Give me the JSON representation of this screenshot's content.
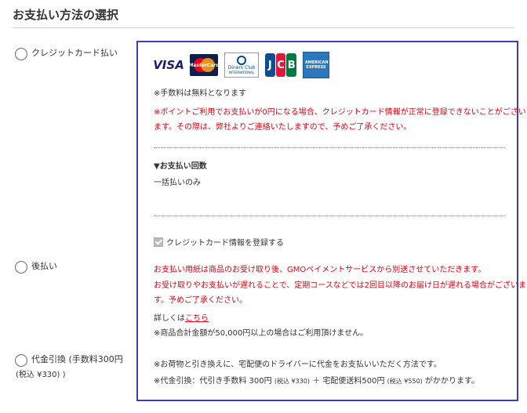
{
  "section": {
    "title": "お支払い方法の選択"
  },
  "payment_options": [
    {
      "label": "クレジットカード払い"
    },
    {
      "label": "後払い"
    },
    {
      "label": "代金引換 (手数料300円",
      "sub": "(税込 ¥330) )"
    }
  ],
  "card_brands": [
    {
      "name": "VISA",
      "icon": "visa-icon"
    },
    {
      "name": "MasterCard",
      "icon": "mastercard-icon"
    },
    {
      "name": "Diners Club",
      "sub": "INTERNATIONAL",
      "icon": "diners-club-icon"
    },
    {
      "name": "JCB",
      "icon": "jcb-icon"
    },
    {
      "name": "AMERICAN EXPRESS",
      "icon": "amex-icon"
    }
  ],
  "credit": {
    "fee_note": "※手数料は無料となります",
    "warning_line1": "※ポイントご利用でお支払いが0円になる場合、クレジットカード情報が正常に登録できないことがござい",
    "warning_line2": "ます。その際は、弊社よりご連絡いたしますので、予めご了承ください。",
    "installments_heading": "▼お支払い回数",
    "installments_value": "一括払いのみ",
    "save_card_label": "クレジットカード情報を登録する"
  },
  "deferred": {
    "line1": "お支払い用紙は商品のお受け取り後、GMOペイメントサービスから別送させていただきます。",
    "line2": "お受け取りやお支払いが遅れることで、定期コースなどでは2回目以降のお届け日が遅れる場合がございま",
    "line3": "す。予めご了承ください。",
    "details_prefix": "詳しくは",
    "details_link": "こちら",
    "limit_note": "※商品合計金額が50,000円以上の場合はご利用頂けません。"
  },
  "cod": {
    "line1": "※お荷物と引き換えに、宅配便のドライバーに代金をお支払いいただく方法です。",
    "fee_prefix": "※代金引換：代引き手数料 300円",
    "fee_tax1": "(税込 ¥330)",
    "fee_mid": "＋ 宅配便送料500円",
    "fee_tax2": "(税込 ¥550)",
    "fee_suffix": "がかかります。"
  },
  "colors": {
    "panel_border": "#3a3fb8",
    "warning": "#e60012"
  }
}
